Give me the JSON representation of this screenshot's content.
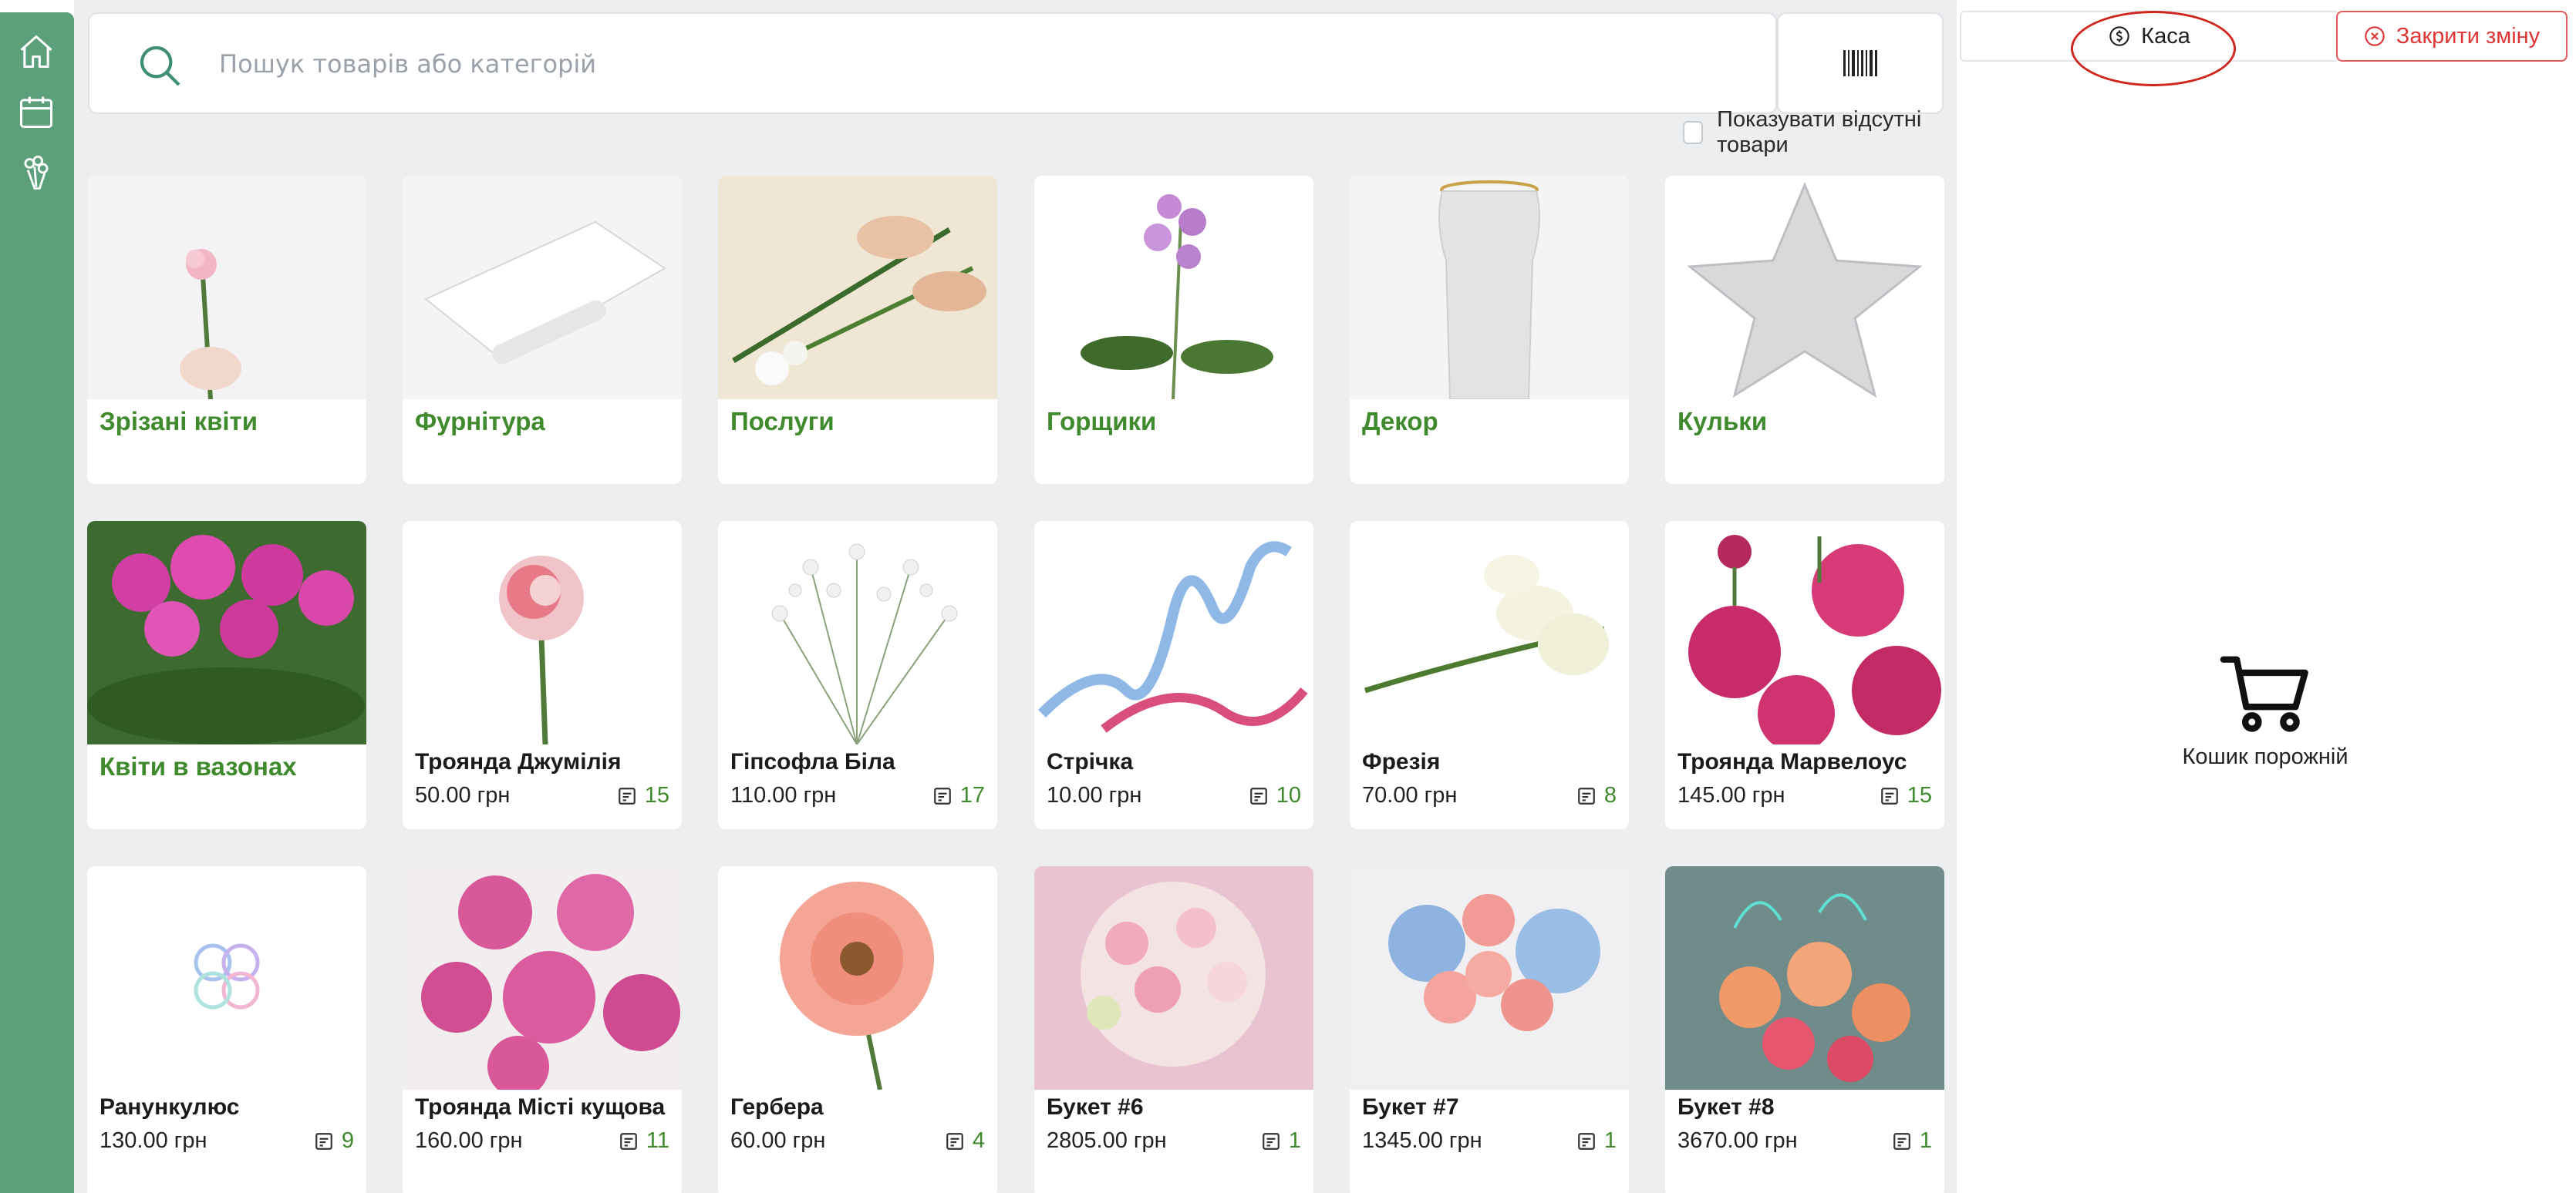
{
  "sidebar": {
    "items": [
      {
        "name": "home",
        "icon": "home-icon"
      },
      {
        "name": "calendar",
        "icon": "calendar-icon"
      },
      {
        "name": "bouquet",
        "icon": "bouquet-icon"
      }
    ]
  },
  "search": {
    "placeholder": "Пошук товарів або категорій",
    "value": ""
  },
  "filters": {
    "show_missing_label": "Показувати відсутні товари",
    "show_missing_checked": false
  },
  "categories": [
    {
      "title": "Зрізані квіти"
    },
    {
      "title": "Фурнітура"
    },
    {
      "title": "Послуги"
    },
    {
      "title": "Горщики"
    },
    {
      "title": "Декор"
    },
    {
      "title": "Кульки"
    },
    {
      "title": "Квіти в вазонах"
    }
  ],
  "products": [
    {
      "title": "Троянда Джумілія",
      "price": "50.00 грн",
      "stock": "15"
    },
    {
      "title": "Гіпсофла Біла",
      "price": "110.00 грн",
      "stock": "17"
    },
    {
      "title": "Стрічка",
      "price": "10.00 грн",
      "stock": "10"
    },
    {
      "title": "Фрезія",
      "price": "70.00 грн",
      "stock": "8"
    },
    {
      "title": "Троянда Марвелоус",
      "price": "145.00 грн",
      "stock": "15"
    },
    {
      "title": "Ранункулюс",
      "price": "130.00 грн",
      "stock": "9"
    },
    {
      "title": "Троянда Місті кущова",
      "price": "160.00 грн",
      "stock": "11"
    },
    {
      "title": "Гербера",
      "price": "60.00 грн",
      "stock": "4"
    },
    {
      "title": "Букет #6",
      "price": "2805.00 грн",
      "stock": "1"
    },
    {
      "title": "Букет #7",
      "price": "1345.00 грн",
      "stock": "1"
    },
    {
      "title": "Букет #8",
      "price": "3670.00 грн",
      "stock": "1"
    }
  ],
  "right_panel": {
    "kasa_label": "Каса",
    "close_shift_label": "Закрити зміну",
    "cart_empty_label": "Кошик порожній"
  },
  "colors": {
    "sidebar": "#5b9f7b",
    "accent_green": "#3f8a2c",
    "danger": "#e03535",
    "annotation_circle": "#d0281f"
  }
}
